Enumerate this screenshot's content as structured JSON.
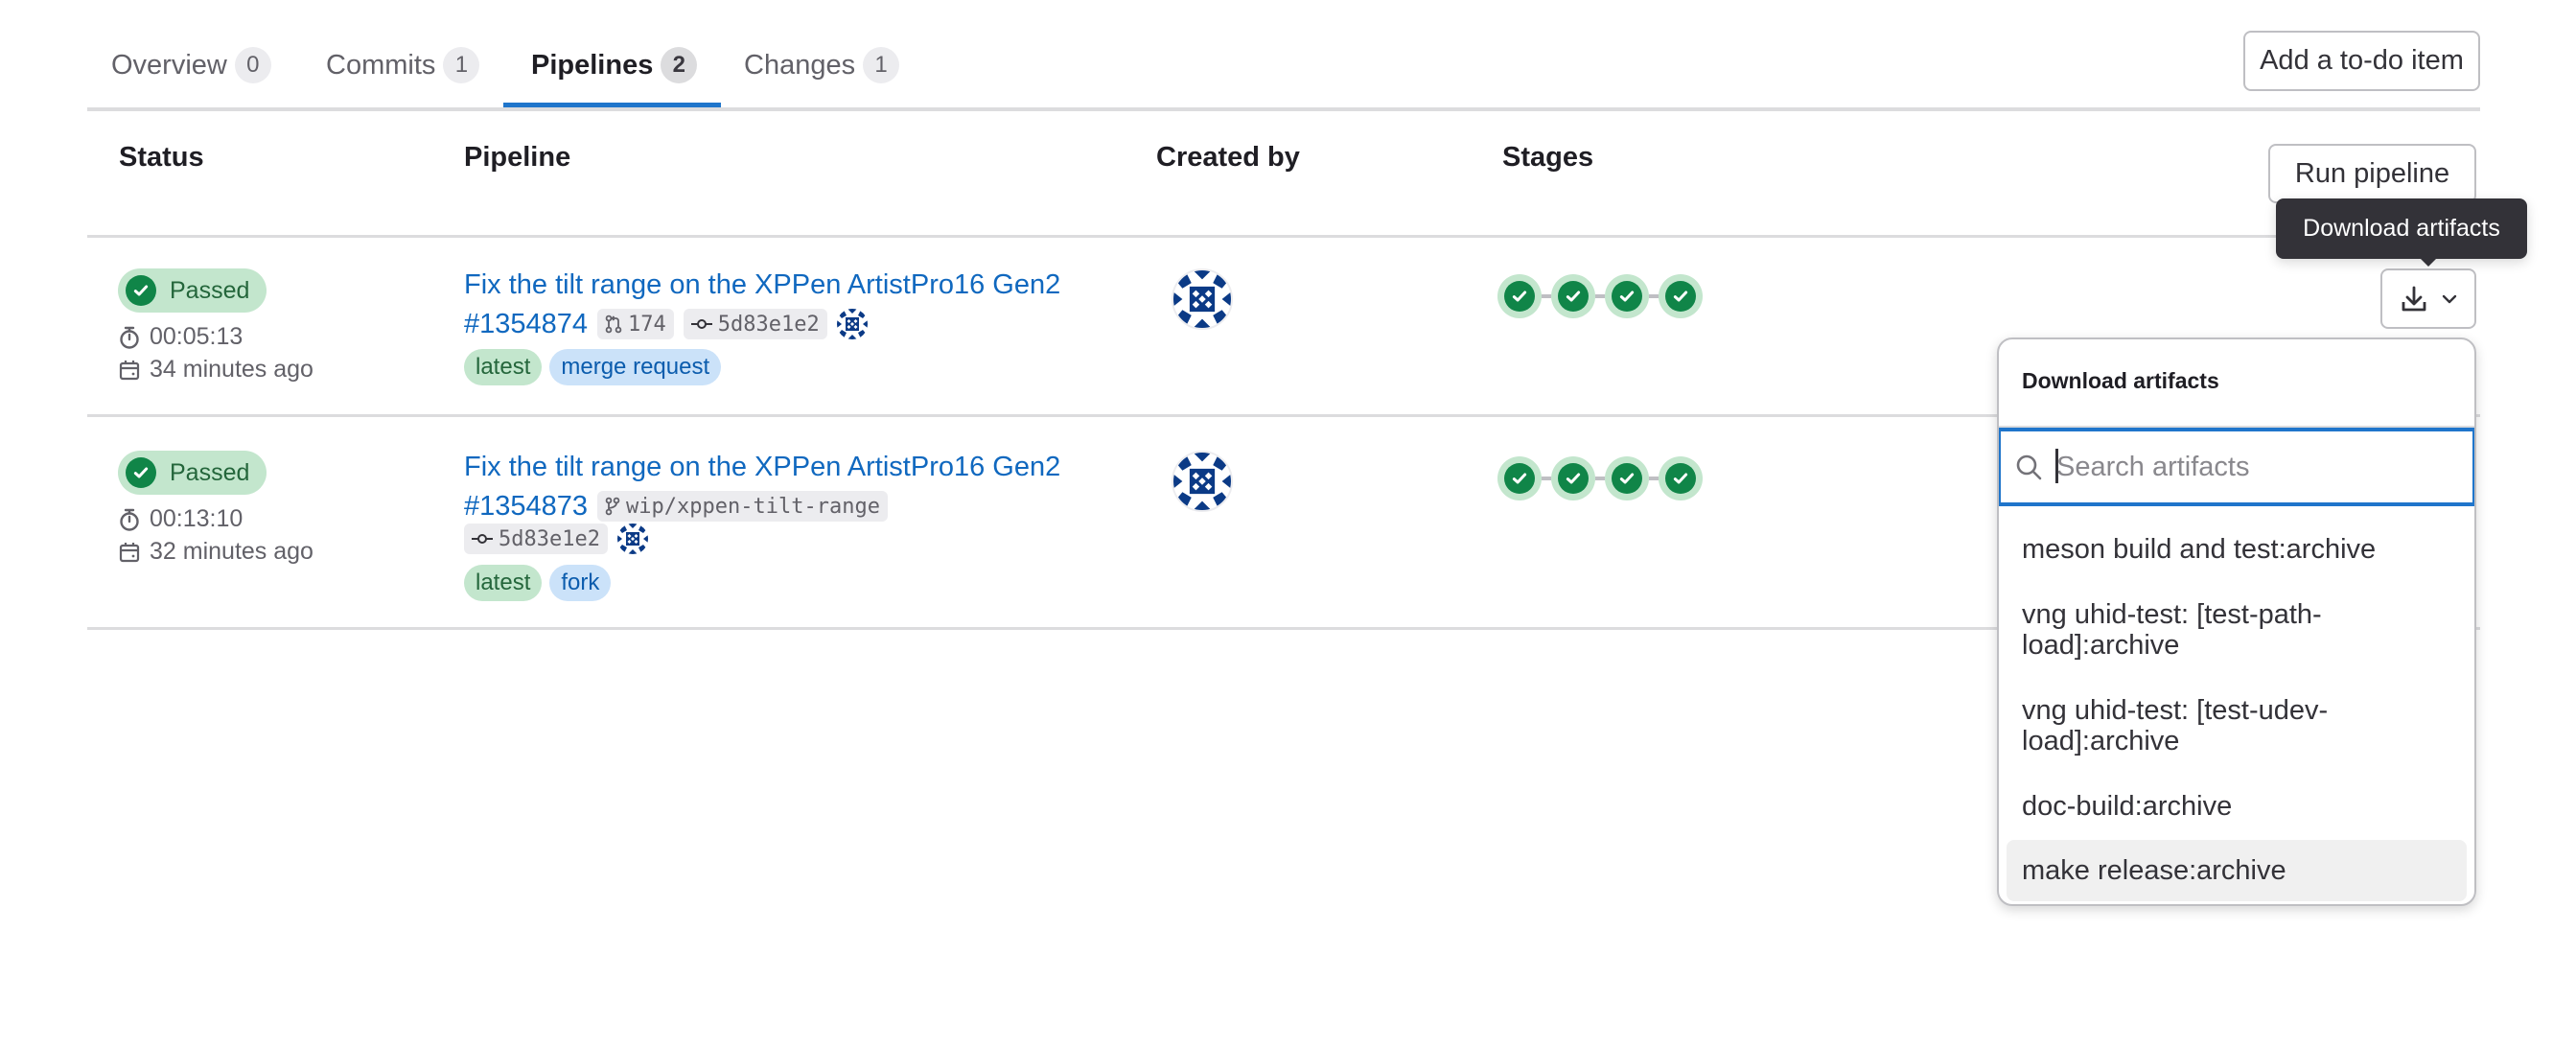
{
  "tabs": [
    {
      "label": "Overview",
      "count": "0",
      "active": false
    },
    {
      "label": "Commits",
      "count": "1",
      "active": false
    },
    {
      "label": "Pipelines",
      "count": "2",
      "active": true
    },
    {
      "label": "Changes",
      "count": "1",
      "active": false
    }
  ],
  "actions": {
    "add_todo_label": "Add a to-do item",
    "run_pipeline_label": "Run pipeline"
  },
  "table": {
    "headers": {
      "status": "Status",
      "pipeline": "Pipeline",
      "created_by": "Created by",
      "stages": "Stages"
    },
    "rows": [
      {
        "status": "Passed",
        "duration": "00:05:13",
        "finished": "34 minutes ago",
        "title": "Fix the tilt range on the XPPen ArtistPro16 Gen2",
        "id": "#1354874",
        "ref_icon": "merge-request-icon",
        "ref": "174",
        "commit": "5d83e1e2",
        "labels": [
          "latest",
          "merge request"
        ],
        "stages": [
          "passed",
          "passed",
          "passed",
          "passed"
        ]
      },
      {
        "status": "Passed",
        "duration": "00:13:10",
        "finished": "32 minutes ago",
        "title": "Fix the tilt range on the XPPen ArtistPro16 Gen2",
        "id": "#1354873",
        "ref_icon": "branch-icon",
        "ref": "wip/xppen-tilt-range",
        "commit": "5d83e1e2",
        "labels": [
          "latest",
          "fork"
        ],
        "stages": [
          "passed",
          "passed",
          "passed",
          "passed"
        ]
      }
    ]
  },
  "tooltip": "Download artifacts",
  "artifacts_dropdown": {
    "header": "Download artifacts",
    "search_placeholder": "Search artifacts",
    "search_value": "",
    "items": [
      "meson build and test:archive",
      "vng uhid-test: [test-path-load]:archive",
      "vng uhid-test: [test-udev-load]:archive",
      "doc-build:archive",
      "make release:archive"
    ],
    "highlighted_index": 4
  },
  "colors": {
    "accent": "#1f75cb",
    "link": "#1068bf",
    "success": "#108548",
    "success_bg": "#c3e6cd",
    "avatar": "#0b3a86"
  }
}
